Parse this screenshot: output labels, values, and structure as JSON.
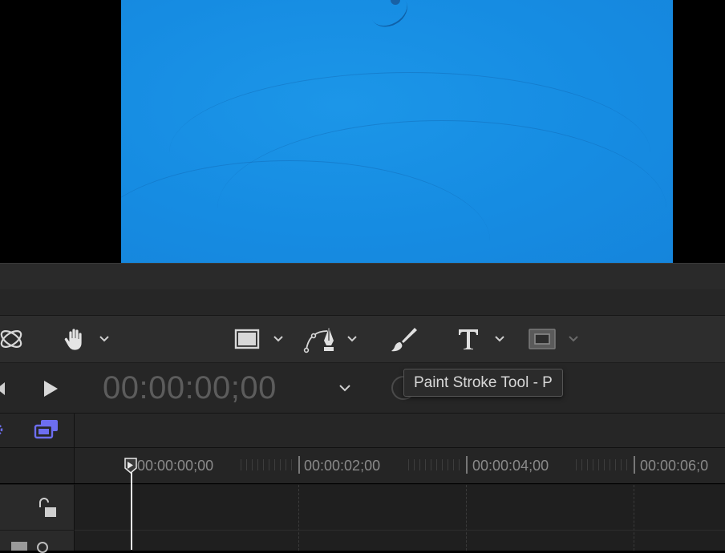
{
  "transport": {
    "timecode": "00:00:00;00"
  },
  "tooltip": {
    "text": "Paint Stroke Tool - P"
  },
  "toolbar": {
    "tools": [
      {
        "name": "3d-transform-tool",
        "icon": "orbit-icon"
      },
      {
        "name": "pan-tool",
        "icon": "hand-icon"
      },
      {
        "name": "shape-tool",
        "icon": "rectangle-icon"
      },
      {
        "name": "bezier-tool",
        "icon": "pen-icon"
      },
      {
        "name": "paint-stroke-tool",
        "icon": "paintbrush-icon"
      },
      {
        "name": "text-tool",
        "icon": "text-T-icon"
      },
      {
        "name": "mask-tool",
        "icon": "mask-icon"
      }
    ]
  },
  "ruler": {
    "labels": [
      "00:00:00;00",
      "00:00:02;00",
      "00:00:04;00",
      "00:00:06;0"
    ]
  },
  "colors": {
    "canvas_blue": "#168ce2",
    "accent_purple": "#6d6ef0"
  }
}
